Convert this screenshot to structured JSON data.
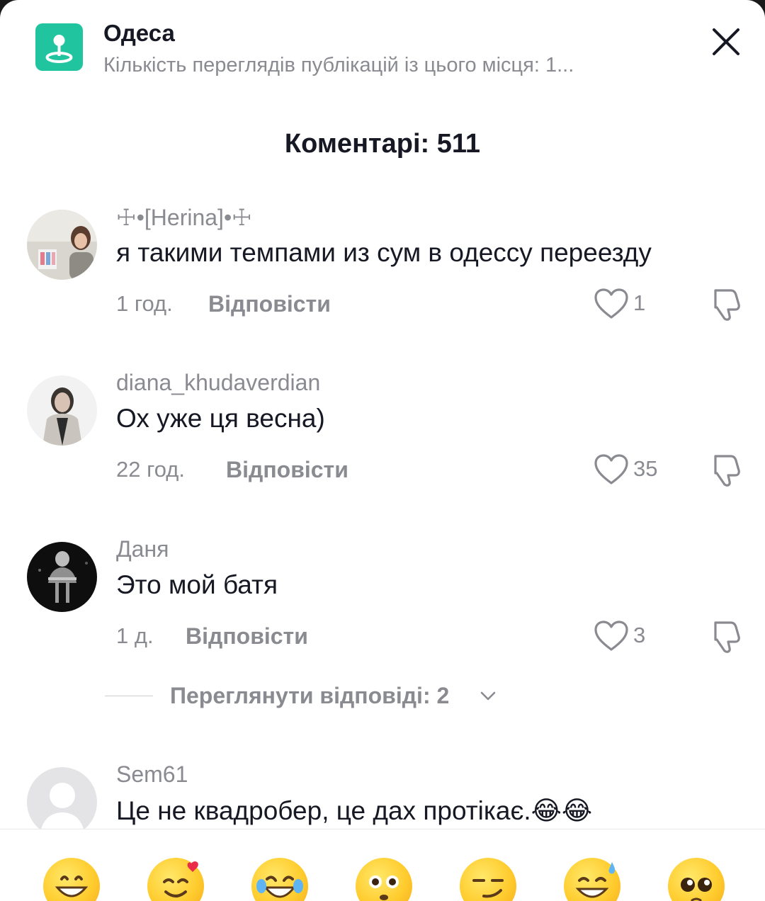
{
  "location": {
    "title": "Одеса",
    "subtitle": "Кількість переглядів публікацій із цього місця: 1...",
    "icon": "location-pin-icon",
    "accent": "#20c5a0"
  },
  "comments_header": {
    "title": "Коментарі: 511"
  },
  "comments": [
    {
      "username": "☩•[Herina]•☩",
      "text": "я такими темпами из сум в одессу переезду",
      "time": "1 год.",
      "reply_label": "Відповісти",
      "likes": "1"
    },
    {
      "username": "diana_khudaverdian",
      "text": "Ох уже ця весна)",
      "time": "22 год.",
      "reply_label": "Відповісти",
      "likes": "35"
    },
    {
      "username": "Даня",
      "text": "Это мой батя",
      "time": "1 д.",
      "reply_label": "Відповісти",
      "likes": "3"
    },
    {
      "username": "Sem61",
      "text": "Це не квадробер, це дах протікає.😂😂"
    }
  ],
  "view_replies": {
    "label": "Переглянути відповіді: 2"
  },
  "emoji_bar": {
    "emojis": [
      "grinning-face",
      "smiling-face-with-hearts",
      "face-with-tears-of-joy",
      "flushed-face",
      "smirking-face",
      "grinning-face-with-sweat",
      "pleading-face"
    ]
  },
  "colors": {
    "text_primary": "#161823",
    "text_secondary": "#8a8b91"
  }
}
